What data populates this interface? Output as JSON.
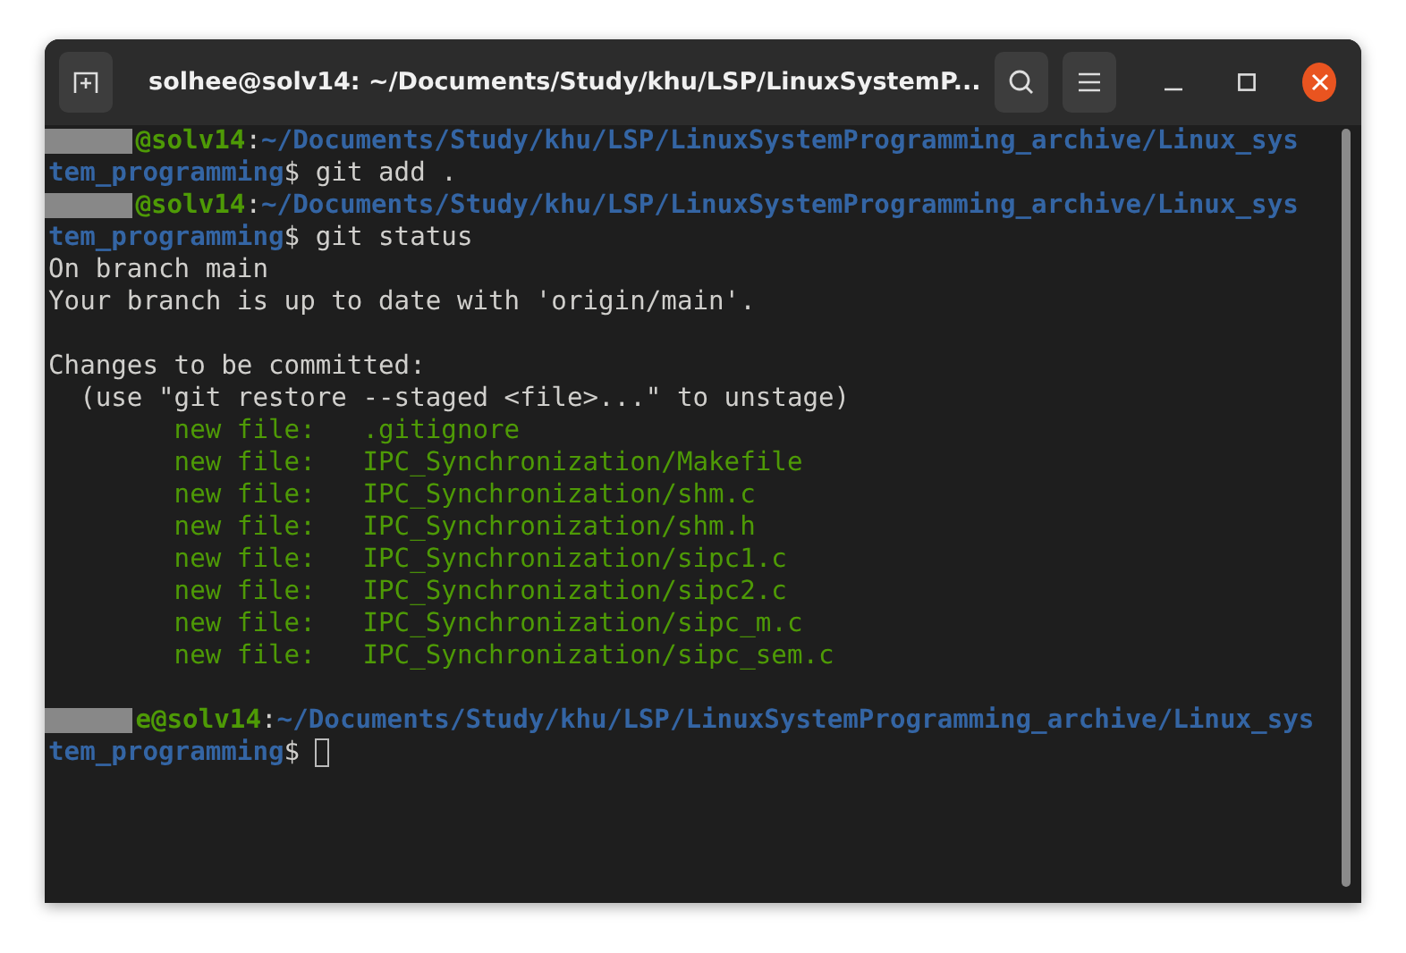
{
  "window": {
    "title": "solhee@solv14: ~/Documents/Study/khu/LSP/LinuxSystemP..."
  },
  "terminal": {
    "lines": [
      {
        "segments": [
          {
            "kind": "redacted"
          },
          {
            "kind": "host",
            "text": "@solv14"
          },
          {
            "kind": "plain",
            "text": ":"
          },
          {
            "kind": "path",
            "text": "~/Documents/Study/khu/LSP/LinuxSystemProgramming_archive/Linux_sys"
          }
        ]
      },
      {
        "segments": [
          {
            "kind": "path",
            "text": "tem_programming"
          },
          {
            "kind": "plain",
            "text": "$ git add ."
          }
        ]
      },
      {
        "segments": [
          {
            "kind": "redacted"
          },
          {
            "kind": "host",
            "text": "@solv14"
          },
          {
            "kind": "plain",
            "text": ":"
          },
          {
            "kind": "path",
            "text": "~/Documents/Study/khu/LSP/LinuxSystemProgramming_archive/Linux_sys"
          }
        ]
      },
      {
        "segments": [
          {
            "kind": "path",
            "text": "tem_programming"
          },
          {
            "kind": "plain",
            "text": "$ git status"
          }
        ]
      },
      {
        "segments": [
          {
            "kind": "plain",
            "text": "On branch main"
          }
        ]
      },
      {
        "segments": [
          {
            "kind": "plain",
            "text": "Your branch is up to date with 'origin/main'."
          }
        ]
      },
      {
        "kind": "blank"
      },
      {
        "segments": [
          {
            "kind": "plain",
            "text": "Changes to be committed:"
          }
        ]
      },
      {
        "segments": [
          {
            "kind": "plain",
            "text": "  (use \"git restore --staged <file>...\" to unstage)"
          }
        ]
      },
      {
        "segments": [
          {
            "kind": "staged",
            "text": "        new file:   .gitignore"
          }
        ]
      },
      {
        "segments": [
          {
            "kind": "staged",
            "text": "        new file:   IPC_Synchronization/Makefile"
          }
        ]
      },
      {
        "segments": [
          {
            "kind": "staged",
            "text": "        new file:   IPC_Synchronization/shm.c"
          }
        ]
      },
      {
        "segments": [
          {
            "kind": "staged",
            "text": "        new file:   IPC_Synchronization/shm.h"
          }
        ]
      },
      {
        "segments": [
          {
            "kind": "staged",
            "text": "        new file:   IPC_Synchronization/sipc1.c"
          }
        ]
      },
      {
        "segments": [
          {
            "kind": "staged",
            "text": "        new file:   IPC_Synchronization/sipc2.c"
          }
        ]
      },
      {
        "segments": [
          {
            "kind": "staged",
            "text": "        new file:   IPC_Synchronization/sipc_m.c"
          }
        ]
      },
      {
        "segments": [
          {
            "kind": "staged",
            "text": "        new file:   IPC_Synchronization/sipc_sem.c"
          }
        ]
      },
      {
        "kind": "blank"
      },
      {
        "segments": [
          {
            "kind": "redacted"
          },
          {
            "kind": "host",
            "text": "e@solv14"
          },
          {
            "kind": "plain",
            "text": ":"
          },
          {
            "kind": "path",
            "text": "~/Documents/Study/khu/LSP/LinuxSystemProgramming_archive/Linux_sys"
          }
        ]
      },
      {
        "segments": [
          {
            "kind": "path",
            "text": "tem_programming"
          },
          {
            "kind": "plain",
            "text": "$ "
          },
          {
            "kind": "cursor"
          }
        ]
      }
    ]
  }
}
